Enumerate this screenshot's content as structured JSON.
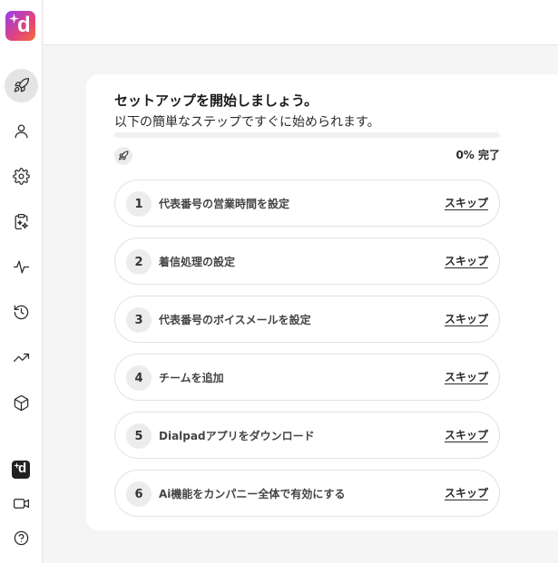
{
  "sidebar": {
    "logo_letter": "d",
    "mini_logo_letter": "d",
    "items": [
      {
        "name": "setup",
        "icon": "rocket-icon",
        "active": true
      },
      {
        "name": "profile",
        "icon": "user-icon",
        "active": false
      },
      {
        "name": "settings",
        "icon": "gear-icon",
        "active": false
      },
      {
        "name": "ai-tasks",
        "icon": "clipboard-sparkle-icon",
        "active": false
      },
      {
        "name": "activity",
        "icon": "pulse-icon",
        "active": false
      },
      {
        "name": "history",
        "icon": "history-icon",
        "active": false
      },
      {
        "name": "analytics",
        "icon": "trending-up-icon",
        "active": false
      },
      {
        "name": "integrations",
        "icon": "cube-icon",
        "active": false
      },
      {
        "name": "meetings",
        "icon": "video-icon",
        "active": false
      },
      {
        "name": "help",
        "icon": "help-icon",
        "active": false
      }
    ]
  },
  "setup": {
    "title": "セットアップを開始しましょう。",
    "subtitle": "以下の簡単なステップですぐに始められます。",
    "progress_percent": 0,
    "progress_label": "0% 完了",
    "skip_label": "スキップ",
    "steps": [
      {
        "number": "1",
        "label": "代表番号の営業時間を設定"
      },
      {
        "number": "2",
        "label": "着信処理の設定"
      },
      {
        "number": "3",
        "label": "代表番号のボイスメールを設定"
      },
      {
        "number": "4",
        "label": "チームを追加"
      },
      {
        "number": "5",
        "label": "Dialpadアプリをダウンロード"
      },
      {
        "number": "6",
        "label": "Ai機能をカンパニー全体で有効にする"
      }
    ]
  },
  "colors": {
    "brand_gradient_start": "#9b3cf0",
    "brand_gradient_end": "#f26c3d",
    "active_nav_bg": "#e4e4e4",
    "progress_fill": "#7c3aed"
  }
}
